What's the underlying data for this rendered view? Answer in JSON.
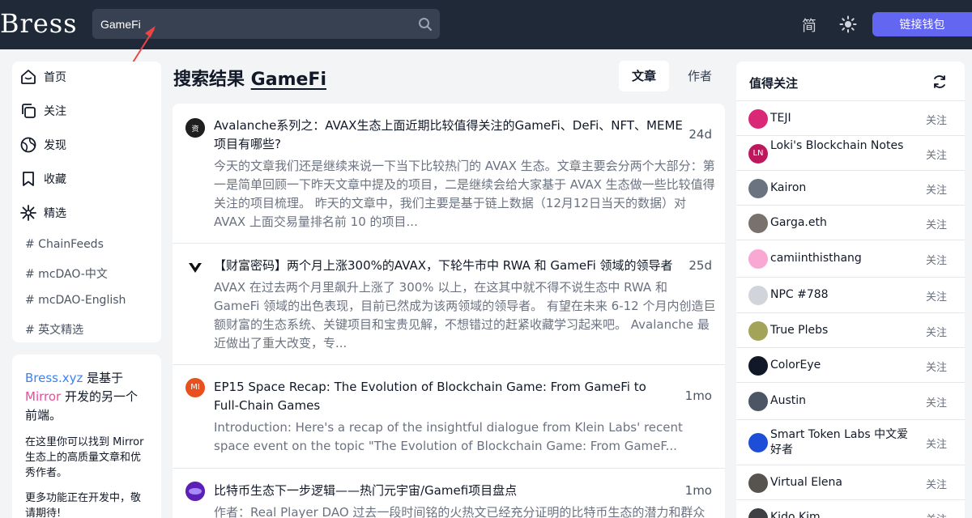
{
  "header": {
    "logo": "Bress",
    "search_value": "GameFi",
    "lang_toggle": "简",
    "wallet_label": "链接钱包"
  },
  "nav": {
    "items": [
      {
        "label": "首页",
        "icon": "home-icon"
      },
      {
        "label": "关注",
        "icon": "copy-icon"
      },
      {
        "label": "发现",
        "icon": "globe-icon"
      },
      {
        "label": "收藏",
        "icon": "bookmark-icon"
      },
      {
        "label": "精选",
        "icon": "sparkle-icon"
      }
    ],
    "tags": [
      "# ChainFeeds",
      "# mcDAO-中文",
      "# mcDAO-English",
      "# 英文精选"
    ]
  },
  "about": {
    "link": "Bress.xyz",
    "text1": " 是基于 ",
    "mirror": "Mirror",
    "text2": " 开发的另一个前端。",
    "p1": "在这里你可以找到 Mirror 生态上的高质量文章和优秀作者。",
    "p2": "更多功能正在开发中，敬请期待!"
  },
  "main": {
    "title_prefix": "搜索结果 ",
    "keyword": "GameFi",
    "tab_article": "文章",
    "tab_author": "作者",
    "results": [
      {
        "title": "Avalanche系列之：AVAX生态上面近期比较值得关注的GameFi、DeFi、NFT、MEME项目有哪些?",
        "time": "24d",
        "excerpt": "今天的文章我们还是继续来说一下当下比较热门的 AVAX 生态。文章主要会分两个大部分：第一是简单回顾一下昨天文章中提及的项目，二是继续会给大家基于 AVAX 生态做一些比较值得关注的项目梳理。 昨天的文章中，我们主要是基于链上数据（12月12日当天的数据）对 AVAX 上面交易量排名前 10 的项目..."
      },
      {
        "title": "【财富密码】两个月上涨300%的AVAX，下轮牛市中 RWA 和 GameFi 领域的领导者",
        "time": "25d",
        "excerpt": "AVAX 在过去两个月里飙升上涨了 300% 以上，在这其中就不得不说生态中 RWA 和 GameFi 领域的出色表现，目前已然成为该两领域的领导者。 有望在未来 6-12 个月内创造巨额财富的生态系统、关键项目和宝贵见解，不想错过的赶紧收藏学习起来吧。 Avalanche 最近做出了重大改变，专..."
      },
      {
        "title": "EP15 Space Recap: The Evolution of Blockchain Game: From GameFi to Full-Chain Games",
        "time": "1mo",
        "avatar_text": "MI",
        "excerpt": "Introduction: Here's a recap of the insightful dialogue from Klein Labs' recent space event on the topic \"The Evolution of Blockchain Game: From GameF..."
      },
      {
        "title": "比特币生态下一步逻辑——热门元宇宙/Gamefi项目盘点",
        "time": "1mo",
        "excerpt": "作者：Real Player DAO 过去一段时间铭的火热文已经充分证明的比特币生态的潜力和群众"
      }
    ]
  },
  "follow": {
    "title": "值得关注",
    "follow_label": "关注",
    "users": [
      {
        "name": "TEJI",
        "color": "#db2777"
      },
      {
        "name": "Loki's Blockchain Notes",
        "color": "#be185d",
        "initials": "LN"
      },
      {
        "name": "Kairon",
        "color": "#6b7280"
      },
      {
        "name": "Garga.eth",
        "color": "#78716c"
      },
      {
        "name": "camiinthisthang",
        "color": "#f9a8d4"
      },
      {
        "name": "NPC #788",
        "color": "#d1d5db"
      },
      {
        "name": "True Plebs",
        "color": "#a3a35a"
      },
      {
        "name": "ColorEye",
        "color": "#111827"
      },
      {
        "name": "Austin",
        "color": "#4b5563"
      },
      {
        "name": "Smart Token Labs 中文爱好者",
        "color": "#1d4ed8"
      },
      {
        "name": "Virtual Elena",
        "color": "#57534e"
      },
      {
        "name": "Kido Kim",
        "color": "#3f3f46"
      }
    ]
  }
}
